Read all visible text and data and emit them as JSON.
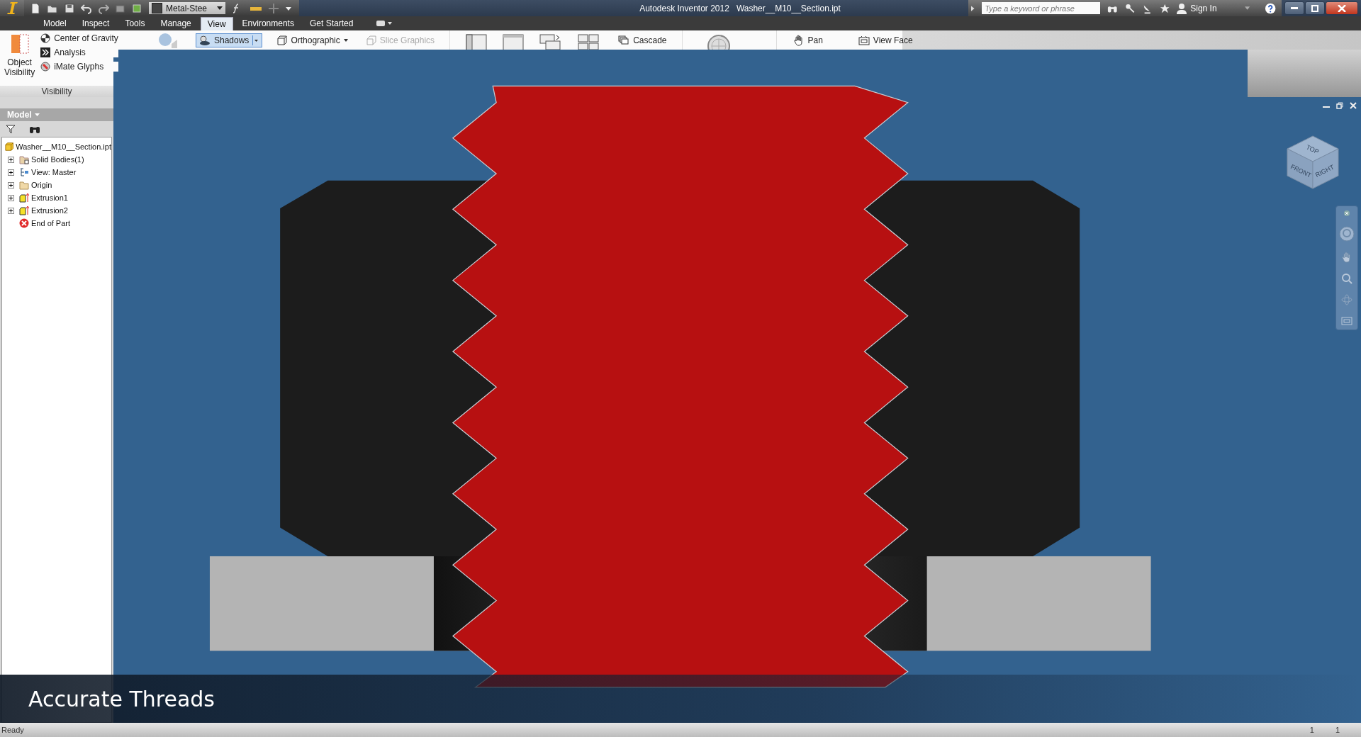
{
  "window": {
    "title": "Autodesk Inventor 2012",
    "document": "Washer__M10__Section.ipt"
  },
  "quick_access": {
    "material": "Metal-Stee"
  },
  "search": {
    "placeholder": "Type a keyword or phrase"
  },
  "account": {
    "label": "Sign In"
  },
  "tabs": [
    {
      "label": "Model",
      "selected": false
    },
    {
      "label": "Inspect",
      "selected": false
    },
    {
      "label": "Tools",
      "selected": false
    },
    {
      "label": "Manage",
      "selected": false
    },
    {
      "label": "View",
      "selected": true
    },
    {
      "label": "Environments",
      "selected": false
    },
    {
      "label": "Get Started",
      "selected": false
    }
  ],
  "visibility_panel": {
    "big_button": "Object Visibility",
    "items": [
      "Center of Gravity",
      "Analysis",
      "iMate Glyphs"
    ],
    "label": "Visibility"
  },
  "ribbon": {
    "appearance": [
      {
        "label": "Shadows",
        "kind": "split",
        "selected": true,
        "disabled": false
      },
      {
        "label": "Orthographic",
        "kind": "dropdown",
        "selected": false,
        "disabled": false
      },
      {
        "label": "Slice Graphics",
        "kind": "plain",
        "selected": false,
        "disabled": true
      }
    ],
    "windows": [
      {
        "label": "Cascade",
        "selected": false,
        "disabled": false
      }
    ],
    "navigate": [
      {
        "label": "Pan",
        "selected": false,
        "disabled": false
      },
      {
        "label": "View Face",
        "selected": false,
        "disabled": false
      }
    ]
  },
  "browser": {
    "title": "Model",
    "tree": [
      {
        "label": "Washer__M10__Section.ipt",
        "kind": "part",
        "children": [
          {
            "label": "Solid Bodies(1)",
            "kind": "bodies",
            "expanded": false
          },
          {
            "label": "View: Master",
            "kind": "view",
            "expanded": false
          },
          {
            "label": "Origin",
            "kind": "folder",
            "expanded": false
          },
          {
            "label": "Extrusion1",
            "kind": "extrusion",
            "expanded": false
          },
          {
            "label": "Extrusion2",
            "kind": "extrusion",
            "expanded": false
          },
          {
            "label": "End of Part",
            "kind": "end"
          }
        ]
      }
    ]
  },
  "view_cube": {
    "faces": [
      "TOP",
      "FRONT",
      "RIGHT"
    ]
  },
  "caption": "Accurate Threads",
  "status_bar": {
    "text": "Ready",
    "values": [
      "1",
      "1"
    ]
  }
}
